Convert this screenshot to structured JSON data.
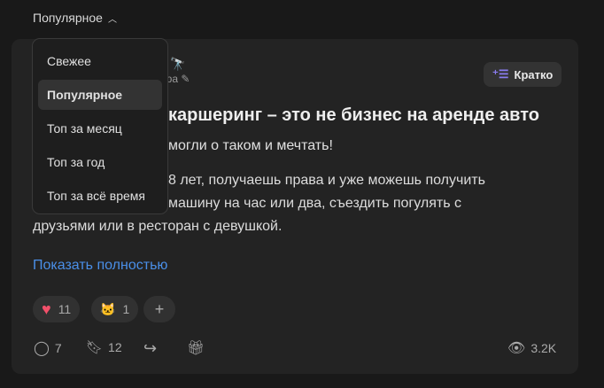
{
  "sort": {
    "label": "Популярное",
    "options": [
      "Свежее",
      "Популярное",
      "Топ за месяц",
      "Топ за год",
      "Топ за всё время"
    ],
    "selected": 1
  },
  "post": {
    "author_fragment": "ера",
    "brief_label": "Кратко",
    "title_fragment": "каршеринг – это не бизнес на аренде авто",
    "lead_fragment": "могли о таком и мечтать!",
    "body_lines": [
      "8 лет, получаешь права и уже можешь получить",
      "машину на час или два, съездить погулять с",
      "друзьями или в ресторан с девушкой."
    ],
    "show_more": "Показать полностью"
  },
  "reactions": [
    {
      "icon": "heart",
      "count": "11"
    },
    {
      "icon": "cat-sunglasses",
      "count": "1"
    }
  ],
  "actions": {
    "comments": "7",
    "bookmarks": "12",
    "views": "3.2K"
  },
  "colors": {
    "accent": "#4a8fe8",
    "heart": "#f2506a",
    "brief_icon": "#8a7cf0"
  }
}
